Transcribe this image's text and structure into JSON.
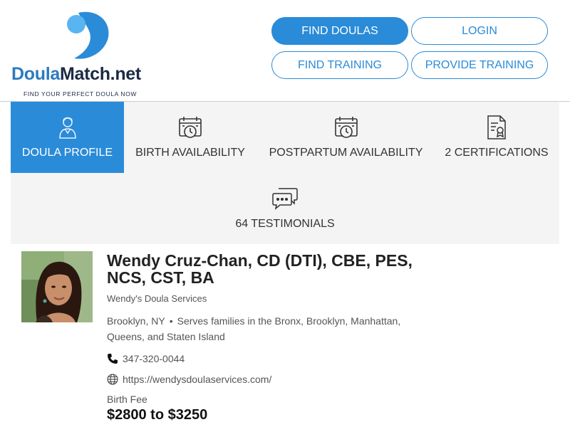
{
  "brand": {
    "name_part1": "Doula",
    "name_part2": "Match.net",
    "tagline": "FIND YOUR PERFECT DOULA NOW",
    "colors": {
      "primary": "#2a8bd8",
      "dark": "#1c2a44",
      "light_blue": "#5ab4f0"
    }
  },
  "nav": {
    "find_doulas": "FIND DOULAS",
    "login": "LOGIN",
    "find_training": "FIND TRAINING",
    "provide_training": "PROVIDE TRAINING"
  },
  "tabs": [
    {
      "label": "DOULA PROFILE",
      "icon": "doula-person-icon",
      "active": true
    },
    {
      "label": "BIRTH AVAILABILITY",
      "icon": "calendar-clock-icon",
      "active": false
    },
    {
      "label": "POSTPARTUM AVAILABILITY",
      "icon": "calendar-clock-icon",
      "active": false
    },
    {
      "label": "2 CERTIFICATIONS",
      "icon": "certificate-icon",
      "active": false
    },
    {
      "label": "64 TESTIMONIALS",
      "icon": "chat-bubbles-icon",
      "active": false
    }
  ],
  "profile": {
    "name": "Wendy Cruz-Chan, CD (DTI), CBE, PES, NCS, CST, BA",
    "business": "Wendy's Doula Services",
    "city": "Brooklyn, NY",
    "serves": "Serves families in the Bronx, Brooklyn, Manhattan, Queens, and Staten Island",
    "phone": "347-320-0044",
    "website": "https://wendysdoulaservices.com/",
    "fee_label": "Birth Fee",
    "fee_value": "$2800 to $3250"
  }
}
